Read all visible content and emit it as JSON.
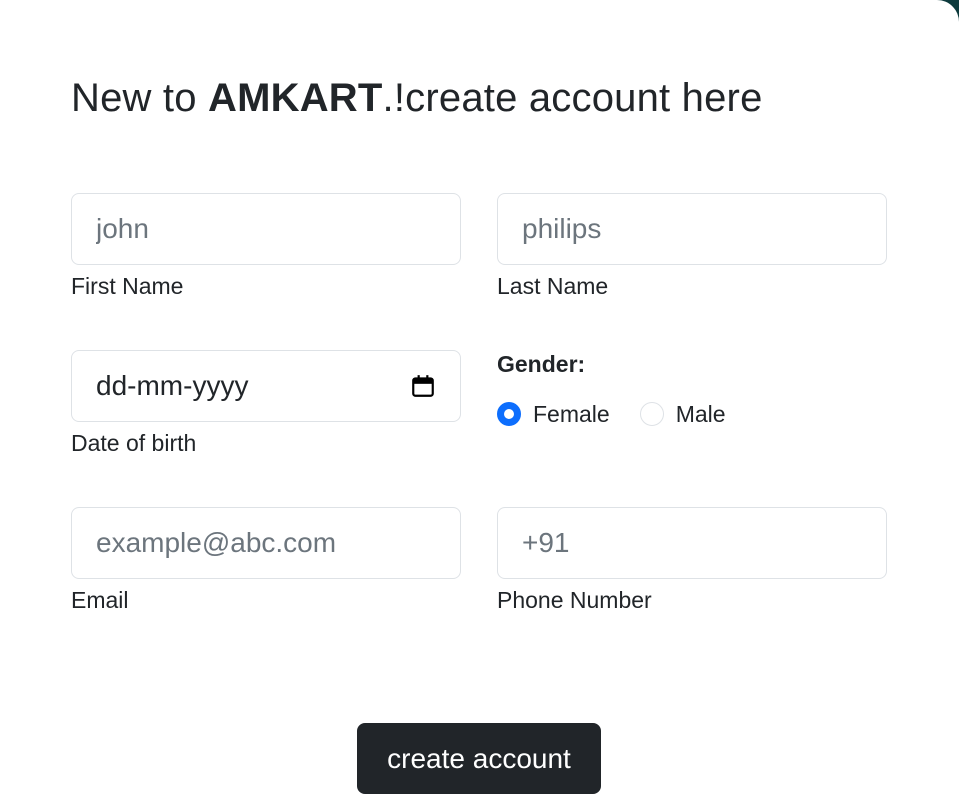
{
  "header": {
    "prefix": "New to ",
    "brand": "AMKART",
    "suffix": ".!create account here"
  },
  "form": {
    "first_name": {
      "placeholder": "john",
      "value": "",
      "label": "First Name"
    },
    "last_name": {
      "placeholder": "philips",
      "value": "",
      "label": "Last Name"
    },
    "dob": {
      "display": "dd-mm-yyyy",
      "label": "Date of birth",
      "icon": "calendar-icon"
    },
    "gender": {
      "label": "Gender:",
      "options": [
        {
          "label": "Female",
          "checked": true
        },
        {
          "label": "Male",
          "checked": false
        }
      ]
    },
    "email": {
      "placeholder": "example@abc.com",
      "value": "",
      "label": "Email"
    },
    "phone": {
      "placeholder": "+91",
      "value": "",
      "label": "Phone Number"
    }
  },
  "submit": {
    "label": "create account"
  },
  "colors": {
    "accent": "#0d6efd",
    "button": "#212529",
    "background": "#0e3b3d"
  }
}
